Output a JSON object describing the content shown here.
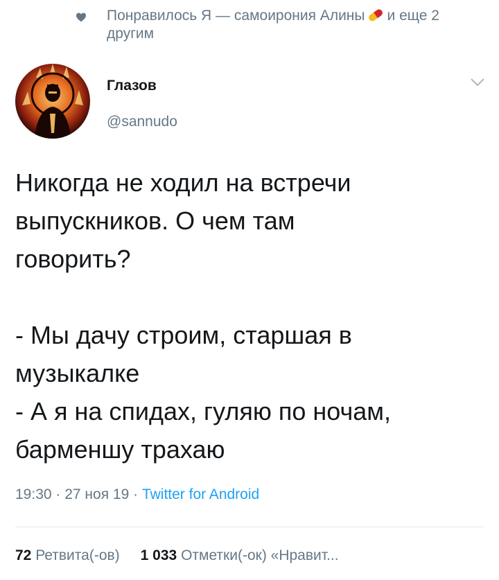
{
  "social_context": {
    "text_before": "Понравилось Я — самоирония Алины",
    "text_after": "и еще 2 другим",
    "icon": "heart-icon",
    "emoji": "pill-icon"
  },
  "author": {
    "display_name": "Глазов",
    "handle": "@sannudo"
  },
  "tweet": {
    "text": "Никогда не ходил на встречи\nвыпускников. О чем там\nговорить?\n\n- Мы дачу строим, старшая в\nмузыкалке\n- А я на спидах, гуляю по ночам,\nбарменшу трахаю"
  },
  "meta": {
    "time": "19:30",
    "separator": " · ",
    "date": "27 ноя 19",
    "source": "Twitter for Android"
  },
  "stats": {
    "retweets_count": "72",
    "retweets_label": "Ретвита(-ов)",
    "likes_count": "1 033",
    "likes_label": "Отметки(-ок) «Нравит..."
  },
  "colors": {
    "secondary": "#657786",
    "link": "#1da1f2",
    "text": "#14171a"
  }
}
